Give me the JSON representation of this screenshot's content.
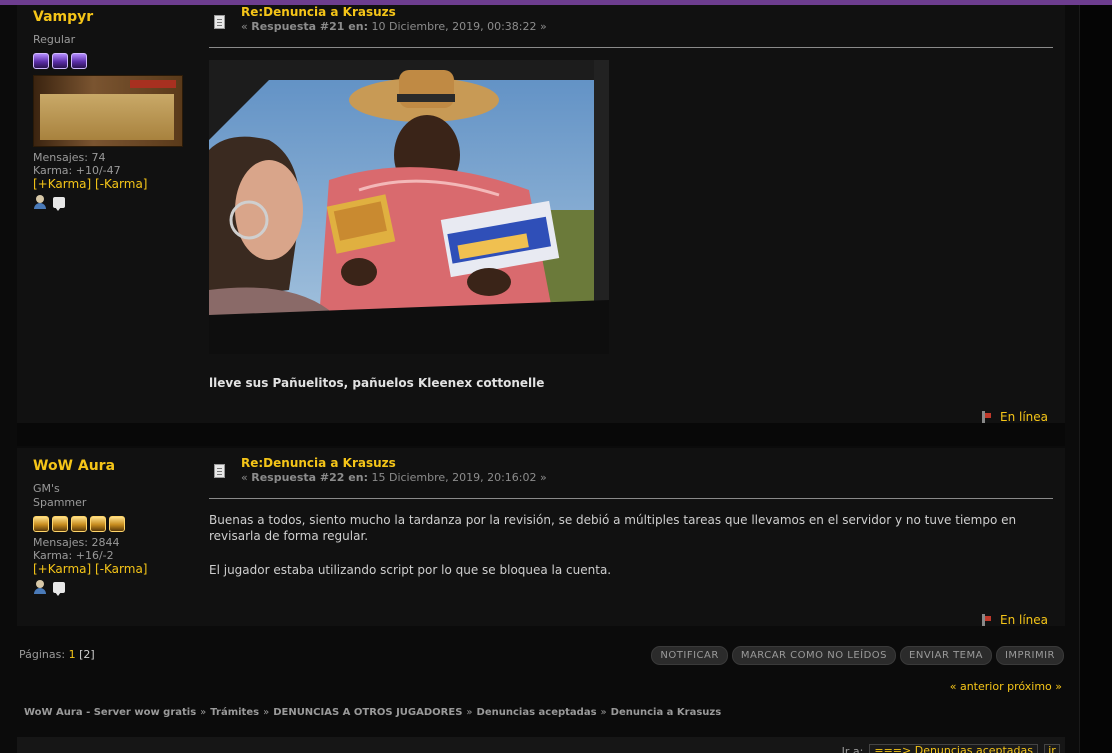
{
  "posts": [
    {
      "author": "Vampyr",
      "group": "Regular",
      "group2": "",
      "stars": 3,
      "star_color": "#8a5cd6",
      "messages": "Mensajes: 74",
      "karma": "Karma: +10/-47",
      "karma_links": "[+Karma] [-Karma]",
      "subject": "Re:Denuncia a Krasuzs",
      "reply_label": "Respuesta #21 en:",
      "date": "10 Diciembre, 2019, 00:38:22",
      "body": [
        "lleve sus Pañuelitos, pañuelos Kleenex cottonelle"
      ],
      "status": "En línea"
    },
    {
      "author": "WoW Aura",
      "group": "GM's",
      "group2": "Spammer",
      "stars": 5,
      "star_color": "#d9a63a",
      "messages": "Mensajes: 2844",
      "karma": "Karma: +16/-2",
      "karma_links": "[+Karma] [-Karma]",
      "subject": "Re:Denuncia a Krasuzs",
      "reply_label": "Respuesta #22 en:",
      "date": "15 Diciembre, 2019, 20:16:02",
      "body": [
        "Buenas a todos, siento mucho la tardanza por la revisión, se debió a múltiples tareas que llevamos en el servidor y no tuve tiempo en revisarla de forma regular.",
        "El jugador estaba utilizando script por lo que se bloquea la cuenta."
      ],
      "status": "En línea"
    }
  ],
  "pagination": {
    "label": "Páginas:",
    "page1": "1",
    "current": "[2]"
  },
  "buttons": [
    "NOTIFICAR",
    "MARCAR COMO NO LEÍDOS",
    "ENVIAR TEMA",
    "IMPRIMIR"
  ],
  "nav": {
    "prev": "« anterior",
    "next": "próximo »"
  },
  "breadcrumb": [
    "WoW Aura - Server wow gratis",
    "Trámites",
    "DENUNCIAS A OTROS JUGADORES",
    "Denuncias aceptadas",
    "Denuncia a Krasuzs"
  ],
  "breadcrumb_sep": "»",
  "jump": {
    "label": "Ir a:",
    "selected": "===> Denuncias aceptadas",
    "go": "ir"
  },
  "colors": {
    "accent": "#f5c518",
    "top_bar": "#6d3d8f",
    "post_bg": "#111111"
  }
}
